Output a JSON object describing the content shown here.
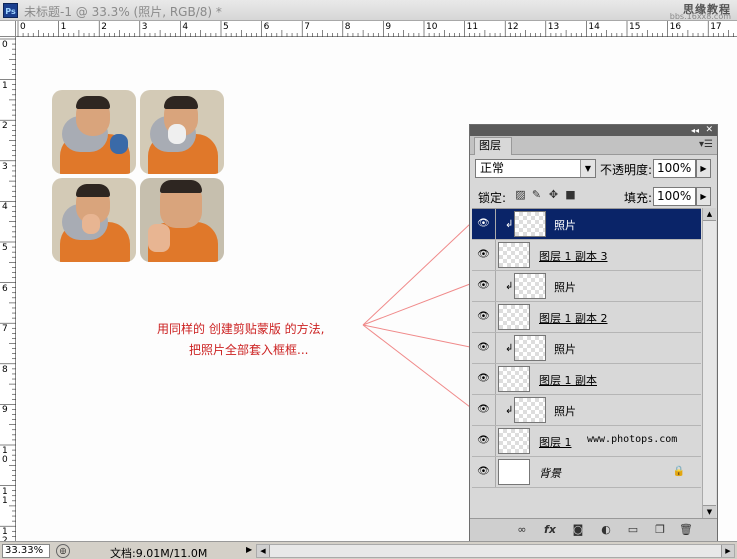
{
  "app": {
    "icon_label": "Ps"
  },
  "window": {
    "title": "未标题-1 @ 33.3% (照片, RGB/8) *"
  },
  "watermark": {
    "line1": "思缘教程",
    "line2": "bbs.16xx8.com"
  },
  "rulers": {
    "horizontal": [
      "0",
      "1",
      "2",
      "3",
      "4",
      "5",
      "6",
      "7",
      "8",
      "9",
      "10",
      "11",
      "12",
      "13",
      "14",
      "15",
      "16",
      "17"
    ],
    "vertical": [
      "0",
      "1",
      "2",
      "3",
      "4",
      "5",
      "6",
      "7",
      "8",
      "9",
      "1 0",
      "1 1",
      "1 2"
    ]
  },
  "annotation": {
    "line1": "用同样的 创建剪贴蒙版 的方法,",
    "line2": "把照片全部套入框框..."
  },
  "layers_panel": {
    "tab": "图层",
    "menu_icon": "panel-menu-icon",
    "blend_mode": "正常",
    "opacity_label": "不透明度:",
    "opacity_value": "100%",
    "lock_label": "锁定:",
    "fill_label": "填充:",
    "fill_value": "100%",
    "layers": [
      {
        "name": "照片",
        "clipped": true,
        "selected": true,
        "thumb": "checker"
      },
      {
        "name": "图层 1 副本 3",
        "clipped": false,
        "selected": false,
        "thumb": "checker"
      },
      {
        "name": "照片",
        "clipped": true,
        "selected": false,
        "thumb": "checker"
      },
      {
        "name": "图层 1 副本 2",
        "clipped": false,
        "selected": false,
        "thumb": "checker"
      },
      {
        "name": "照片",
        "clipped": true,
        "selected": false,
        "thumb": "checker"
      },
      {
        "name": "图层 1 副本",
        "clipped": false,
        "selected": false,
        "thumb": "checker"
      },
      {
        "name": "照片",
        "clipped": true,
        "selected": false,
        "thumb": "checker"
      },
      {
        "name": "图层 1",
        "clipped": false,
        "selected": false,
        "thumb": "checker",
        "extra": "www.photops.com"
      },
      {
        "name": "背景",
        "clipped": false,
        "selected": false,
        "thumb": "white",
        "locked": true
      }
    ],
    "footer_icons": [
      "link-icon",
      "fx-icon",
      "mask-icon",
      "adjustment-icon",
      "folder-icon",
      "new-layer-icon",
      "trash-icon"
    ]
  },
  "status": {
    "zoom": "33.33%",
    "doc_info": "文档:9.01M/11.0M"
  },
  "colors": {
    "selection": "#0a2468",
    "annotation": "#cc2222",
    "annotation_lines": "#f08a8a"
  }
}
